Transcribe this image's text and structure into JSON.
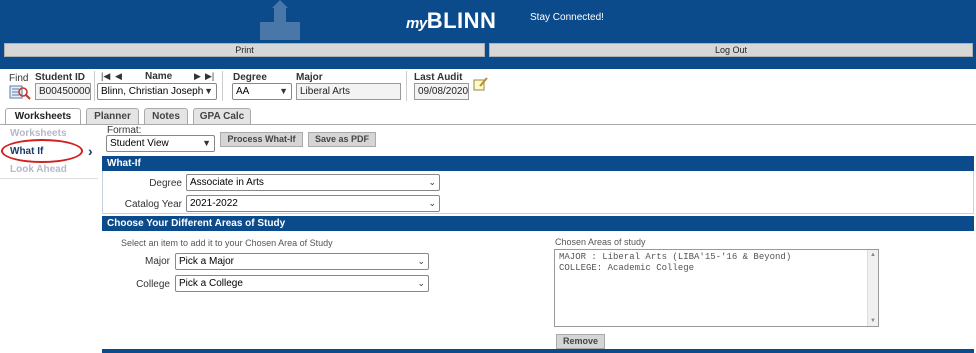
{
  "header": {
    "logo_my": "my",
    "logo_blinn": "BLINN",
    "tagline": "Stay Connected!",
    "print_label": "Print",
    "logout_label": "Log Out"
  },
  "student": {
    "find_label": "Find",
    "id_label": "Student ID",
    "id_value": "B00450000",
    "name_label": "Name",
    "name_value": "Blinn, Christian Joseph",
    "degree_label": "Degree",
    "degree_value": "AA",
    "major_label": "Major",
    "major_value": "Liberal Arts",
    "audit_label": "Last Audit",
    "audit_value": "09/08/2020"
  },
  "tabs": [
    "Worksheets",
    "Planner",
    "Notes",
    "GPA Calc"
  ],
  "nav": {
    "items": [
      "Worksheets",
      "What If",
      "Look Ahead"
    ],
    "active": "What If"
  },
  "toolbar": {
    "format_label": "Format:",
    "format_value": "Student View",
    "process_label": "Process What-If",
    "pdf_label": "Save as PDF"
  },
  "whatif": {
    "header": "What-If",
    "degree_label": "Degree",
    "degree_value": "Associate in Arts",
    "catalog_label": "Catalog Year",
    "catalog_value": "2021-2022"
  },
  "areas": {
    "header": "Choose Your Different Areas of Study",
    "hint": "Select an item to add it to your Chosen Area of Study",
    "major_label": "Major",
    "major_value": "Pick a Major",
    "college_label": "College",
    "college_value": "Pick a College",
    "chosen_label": "Chosen Areas of study",
    "chosen_items": [
      "MAJOR : Liberal Arts (LIBA'15-'16 & Beyond)",
      "COLLEGE: Academic College"
    ],
    "remove_label": "Remove"
  },
  "colors": {
    "brand_blue": "#0b4a8b",
    "highlight_red": "#d21f1f"
  }
}
